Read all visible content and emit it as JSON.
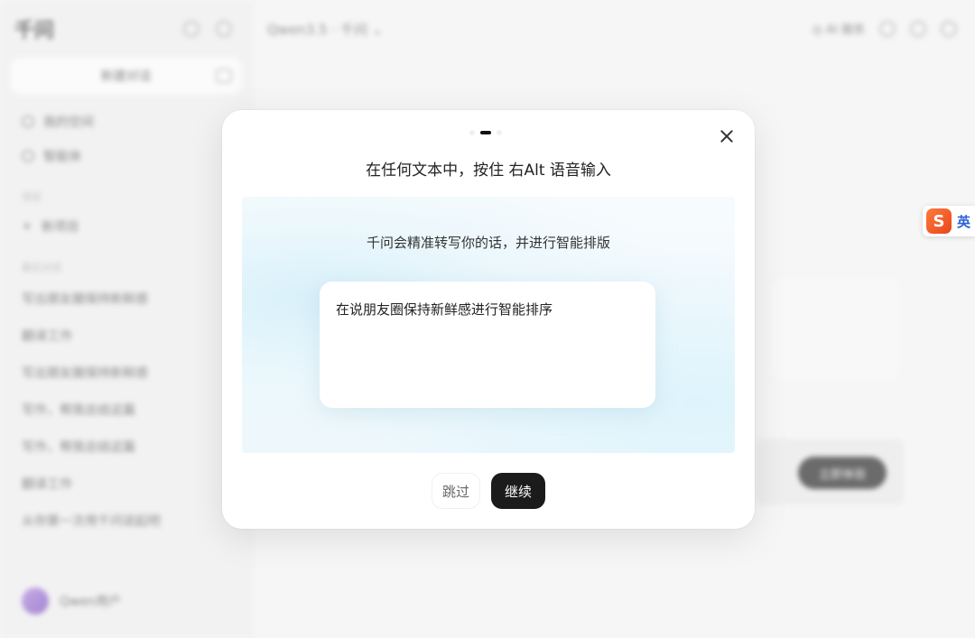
{
  "sidebar": {
    "logo": "千问",
    "new_chat": "新建对话",
    "items": [
      {
        "label": "我的空间"
      },
      {
        "label": "智能体"
      }
    ],
    "section_project": "项目",
    "project_item": "新项目",
    "section_history": "最近对话",
    "history": [
      "写出朋友圈保持新鲜感",
      "翻译工作",
      "写出朋友圈保持新鲜感",
      "写作，帮我总结这篇",
      "写作，帮我总结这篇",
      "翻译工作",
      "从你第一次用千问说起吧"
    ],
    "user_name": "Qwen用户"
  },
  "main": {
    "model_label": "Qwen3.5 · 千问",
    "top_right_label": "AI 服务",
    "pill_label": "立即体验"
  },
  "modal": {
    "title": "在任何文本中，按住 右Alt 语音输入",
    "demo_subtitle": "千问会精准转写你的话，并进行智能排版",
    "demo_text": "在说朋友圈保持新鲜感进行智能排序",
    "skip_label": "跳过",
    "next_label": "继续",
    "steps_total": 3,
    "active_step": 2
  },
  "ime": {
    "logo": "S",
    "lang": "英"
  }
}
